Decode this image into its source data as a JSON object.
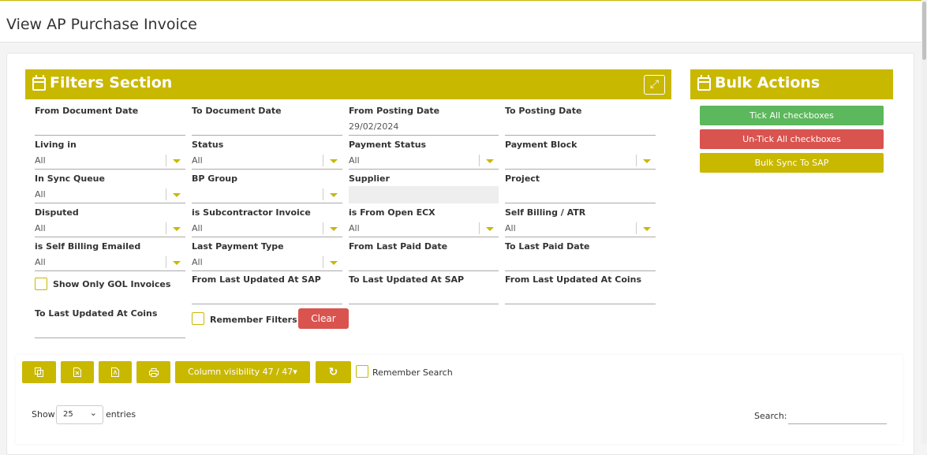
{
  "page": {
    "title": "View AP Purchase Invoice"
  },
  "filters": {
    "title": "Filters Section",
    "fields": {
      "from_document_date": {
        "label": "From Document Date",
        "value": ""
      },
      "to_document_date": {
        "label": "To Document Date",
        "value": ""
      },
      "from_posting_date": {
        "label": "From Posting Date",
        "value": "29/02/2024"
      },
      "to_posting_date": {
        "label": "To Posting Date",
        "value": ""
      },
      "living_in": {
        "label": "Living in",
        "value": "All"
      },
      "status": {
        "label": "Status",
        "value": "All"
      },
      "payment_status": {
        "label": "Payment Status",
        "value": "All"
      },
      "payment_block": {
        "label": "Payment Block",
        "value": ""
      },
      "in_sync_queue": {
        "label": "In Sync Queue",
        "value": "All"
      },
      "bp_group": {
        "label": "BP Group",
        "value": ""
      },
      "supplier": {
        "label": "Supplier",
        "value": ""
      },
      "project": {
        "label": "Project",
        "value": ""
      },
      "disputed": {
        "label": "Disputed",
        "value": "All"
      },
      "is_subcontractor_invoice": {
        "label": "is Subcontractor Invoice",
        "value": "All"
      },
      "is_from_open_ecx": {
        "label": "is From Open ECX",
        "value": "All"
      },
      "self_billing_atr": {
        "label": "Self Billing / ATR",
        "value": "All"
      },
      "is_self_billing_emailed": {
        "label": "is Self Billing Emailed",
        "value": "All"
      },
      "last_payment_type": {
        "label": "Last Payment Type",
        "value": "All"
      },
      "from_last_paid_date": {
        "label": "From Last Paid Date",
        "value": ""
      },
      "to_last_paid_date": {
        "label": "To Last Paid Date",
        "value": ""
      },
      "from_last_updated_sap": {
        "label": "From Last Updated At SAP",
        "value": ""
      },
      "to_last_updated_sap": {
        "label": "To Last Updated At SAP",
        "value": ""
      },
      "from_last_updated_coins": {
        "label": "From Last Updated At Coins",
        "value": ""
      },
      "to_last_updated_coins": {
        "label": "To Last Updated At Coins",
        "value": ""
      }
    },
    "show_only_gol_label": "Show Only GOL Invoices",
    "remember_filters_label": "Remember Filters",
    "clear_label": "Clear"
  },
  "bulk": {
    "title": "Bulk Actions",
    "tick_all": "Tick All checkboxes",
    "untick_all": "Un-Tick All checkboxes",
    "bulk_sync": "Bulk Sync To SAP"
  },
  "table": {
    "column_visibility": "Column visibility 47 / 47▾",
    "remember_search": "Remember Search",
    "show_label": "Show",
    "entries_value": "25",
    "entries_label": "entries",
    "search_label": "Search:"
  },
  "colors": {
    "accent": "#c9b800",
    "success": "#5cb85c",
    "danger": "#d9534f"
  }
}
